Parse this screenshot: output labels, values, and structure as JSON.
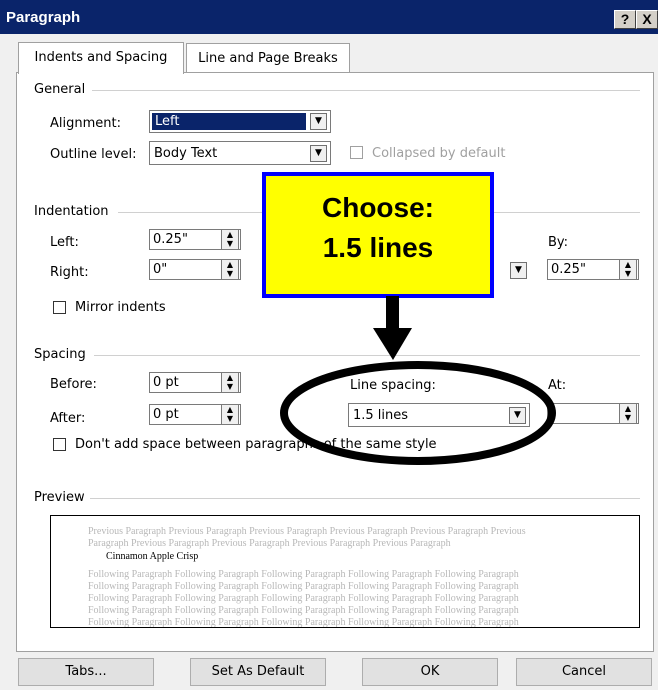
{
  "window": {
    "title": "Paragraph",
    "help": "?",
    "close": "X"
  },
  "tabs": [
    {
      "label": "Indents and Spacing",
      "selected": true
    },
    {
      "label": "Line and Page Breaks",
      "selected": false
    }
  ],
  "general": {
    "heading": "General",
    "alignment_label": "Alignment:",
    "alignment_value": "Left",
    "outline_label": "Outline level:",
    "outline_value": "Body Text",
    "collapsed_label": "Collapsed by default"
  },
  "indentation": {
    "heading": "Indentation",
    "left_label": "Left:",
    "left_value": "0.25\"",
    "right_label": "Right:",
    "right_value": "0\"",
    "by_label": "By:",
    "by_value": "0.25\"",
    "mirror_label": "Mirror indents"
  },
  "spacing": {
    "heading": "Spacing",
    "before_label": "Before:",
    "before_value": "0 pt",
    "after_label": "After:",
    "after_value": "0 pt",
    "line_spacing_label": "Line spacing:",
    "line_spacing_value": "1.5 lines",
    "at_label": "At:",
    "at_value": "",
    "dont_add_label": "Don't add space between paragraphs of the same style"
  },
  "preview": {
    "heading": "Preview",
    "prev1": "Previous Paragraph Previous Paragraph Previous Paragraph Previous Paragraph Previous Paragraph Previous",
    "prev2": "Paragraph Previous Paragraph Previous Paragraph Previous Paragraph Previous Paragraph",
    "sample": "Cinnamon Apple Crisp",
    "follow": "Following Paragraph Following Paragraph Following Paragraph Following Paragraph Following Paragraph"
  },
  "callout": {
    "line1": "Choose:",
    "line2": "1.5 lines"
  },
  "buttons": {
    "tabs": "Tabs...",
    "default": "Set As Default",
    "ok": "OK",
    "cancel": "Cancel"
  },
  "colors": {
    "titlebar": "#0a246a",
    "callout_fill": "#ffff00",
    "callout_border": "#0000ff"
  }
}
